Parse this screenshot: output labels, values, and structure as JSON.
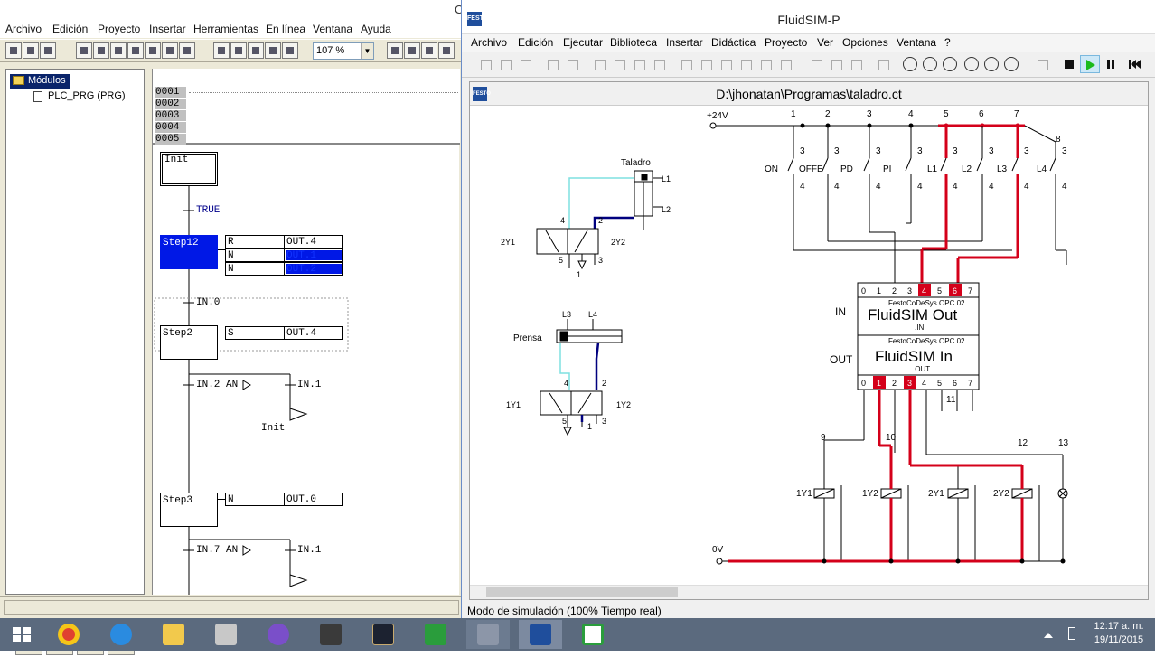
{
  "codesys": {
    "title_fragment": "C",
    "menu": [
      "Archivo",
      "Edición",
      "Proyecto",
      "Insertar",
      "Herramientas",
      "En línea",
      "Ventana",
      "Ayuda"
    ],
    "zoom": "107 %",
    "tree": {
      "root": "Módulos",
      "child": "PLC_PRG (PRG)"
    },
    "decl_lines": [
      "0001",
      "0002",
      "0003",
      "0004",
      "0005"
    ],
    "sfc": {
      "init_step": "Init",
      "t_true": "TRUE",
      "step12": "Step12",
      "step12_actions": [
        {
          "q": "R",
          "name": "OUT.4"
        },
        {
          "q": "N",
          "name": "OUT.1"
        },
        {
          "q": "N",
          "name": "OUT.2"
        }
      ],
      "t_in0": "IN.0",
      "step2": "Step2",
      "step2_action": {
        "q": "S",
        "name": "OUT.4"
      },
      "t_in2": "IN.2 AN",
      "t_in1_a": "IN.1",
      "jump_init": "Init",
      "step3": "Step3",
      "step3_action": {
        "q": "N",
        "name": "OUT.0"
      },
      "t_in7": "IN.7 AN",
      "t_in1_b": "IN.1"
    }
  },
  "fluidsim": {
    "title": "FluidSIM-P",
    "menu": [
      "Archivo",
      "Edición",
      "Ejecutar",
      "Biblioteca",
      "Insertar",
      "Didáctica",
      "Proyecto",
      "Ver",
      "Opciones",
      "Ventana",
      "?"
    ],
    "doc_title": "D:\\jhonatan\\Programas\\taladro.ct",
    "status": "Modo de simulación (100% Tiempo real)",
    "colors": {
      "active": "#d4001a",
      "wire": "#000000",
      "pneumatic_cyan": "#7fe0e0",
      "pneumatic_blue": "#00007f"
    },
    "circuit": {
      "supply_pos": "+24V",
      "supply_neg": "0V",
      "column_numbers": [
        "1",
        "2",
        "3",
        "4",
        "5",
        "6",
        "7"
      ],
      "switch_labels": [
        "ON",
        "OFFE",
        "PD",
        "PI",
        "L1",
        "L2",
        "L3",
        "L4"
      ],
      "contact_top": "3",
      "contact_bottom": "4",
      "extra_label": "8",
      "in_label": "IN",
      "out_label": "OUT",
      "opc_header": "FestoCoDeSys.OPC.02",
      "fluid_out": "FluidSIM Out",
      "fluid_out_sub": ".IN",
      "fluid_in": "FluidSIM In",
      "fluid_in_sub": ".OUT",
      "pins": [
        "0",
        "1",
        "2",
        "3",
        "4",
        "5",
        "6",
        "7"
      ],
      "wire_numbers": [
        "9",
        "10",
        "11",
        "12",
        "13"
      ],
      "coils": [
        "1Y1",
        "1Y2",
        "2Y1",
        "2Y2"
      ],
      "drill_label": "Taladro",
      "press_label": "Prensa",
      "limit_labels": [
        "L1",
        "L2",
        "L3",
        "L4"
      ],
      "valve_ports": [
        "4",
        "2",
        "5",
        "1",
        "3"
      ]
    }
  },
  "taskbar": {
    "time": "12:17 a. m.",
    "date": "19/11/2015"
  }
}
